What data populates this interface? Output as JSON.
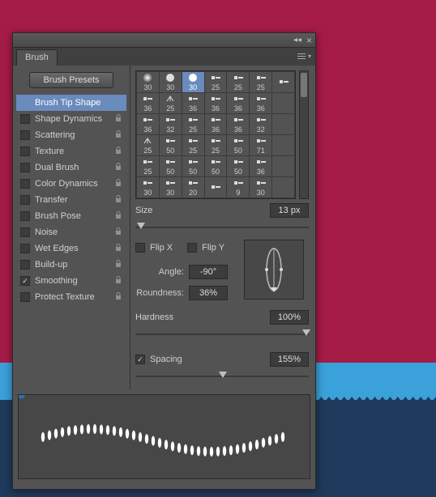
{
  "panel": {
    "tab": "Brush"
  },
  "sidebar": {
    "presets_btn": "Brush Presets",
    "items": [
      {
        "label": "Brush Tip Shape",
        "check": null,
        "active": true,
        "lock": false
      },
      {
        "label": "Shape Dynamics",
        "check": false,
        "active": false,
        "lock": true
      },
      {
        "label": "Scattering",
        "check": false,
        "active": false,
        "lock": true
      },
      {
        "label": "Texture",
        "check": false,
        "active": false,
        "lock": true
      },
      {
        "label": "Dual Brush",
        "check": false,
        "active": false,
        "lock": true
      },
      {
        "label": "Color Dynamics",
        "check": false,
        "active": false,
        "lock": true
      },
      {
        "label": "Transfer",
        "check": false,
        "active": false,
        "lock": true
      },
      {
        "label": "Brush Pose",
        "check": false,
        "active": false,
        "lock": true
      },
      {
        "label": "Noise",
        "check": false,
        "active": false,
        "lock": true
      },
      {
        "label": "Wet Edges",
        "check": false,
        "active": false,
        "lock": true
      },
      {
        "label": "Build-up",
        "check": false,
        "active": false,
        "lock": true
      },
      {
        "label": "Smoothing",
        "check": true,
        "active": false,
        "lock": true
      },
      {
        "label": "Protect Texture",
        "check": false,
        "active": false,
        "lock": true
      }
    ]
  },
  "tips": [
    [
      {
        "v": "30",
        "s": "soft"
      },
      {
        "v": "30",
        "s": "hard"
      },
      {
        "v": "30",
        "s": "hard",
        "sel": true
      },
      {
        "v": "25",
        "s": "flat"
      },
      {
        "v": "25",
        "s": "flat"
      },
      {
        "v": "25",
        "s": "flat"
      },
      {
        "v": "",
        "s": "flat"
      }
    ],
    [
      {
        "v": "36",
        "s": "flat"
      },
      {
        "v": "25",
        "s": "fan"
      },
      {
        "v": "36",
        "s": "flat"
      },
      {
        "v": "36",
        "s": "flat"
      },
      {
        "v": "36",
        "s": "flat"
      },
      {
        "v": "36",
        "s": "flat"
      },
      {
        "v": "",
        "s": ""
      }
    ],
    [
      {
        "v": "36",
        "s": "flat"
      },
      {
        "v": "32",
        "s": "flat"
      },
      {
        "v": "25",
        "s": "flat"
      },
      {
        "v": "36",
        "s": "flat"
      },
      {
        "v": "36",
        "s": "flat"
      },
      {
        "v": "32",
        "s": "flat"
      },
      {
        "v": "",
        "s": ""
      }
    ],
    [
      {
        "v": "25",
        "s": "fan"
      },
      {
        "v": "50",
        "s": "flat"
      },
      {
        "v": "25",
        "s": "flat"
      },
      {
        "v": "25",
        "s": "flat"
      },
      {
        "v": "50",
        "s": "flat"
      },
      {
        "v": "71",
        "s": "flat"
      },
      {
        "v": "",
        "s": ""
      }
    ],
    [
      {
        "v": "25",
        "s": "flat"
      },
      {
        "v": "50",
        "s": "flat"
      },
      {
        "v": "50",
        "s": "flat"
      },
      {
        "v": "50",
        "s": "flat"
      },
      {
        "v": "50",
        "s": "flat"
      },
      {
        "v": "36",
        "s": "flat"
      },
      {
        "v": "",
        "s": ""
      }
    ],
    [
      {
        "v": "30",
        "s": "flat"
      },
      {
        "v": "30",
        "s": "flat"
      },
      {
        "v": "20",
        "s": "flat"
      },
      {
        "v": "",
        "s": "flat"
      },
      {
        "v": "9",
        "s": "flat"
      },
      {
        "v": "30",
        "s": "flat"
      },
      {
        "v": "",
        "s": ""
      }
    ]
  ],
  "controls": {
    "size_label": "Size",
    "size_value": "13 px",
    "flipx_label": "Flip X",
    "flipy_label": "Flip Y",
    "angle_label": "Angle:",
    "angle_value": "-90°",
    "roundness_label": "Roundness:",
    "roundness_value": "36%",
    "hardness_label": "Hardness",
    "hardness_value": "100%",
    "spacing_label": "Spacing",
    "spacing_checked": true,
    "spacing_value": "155%"
  }
}
